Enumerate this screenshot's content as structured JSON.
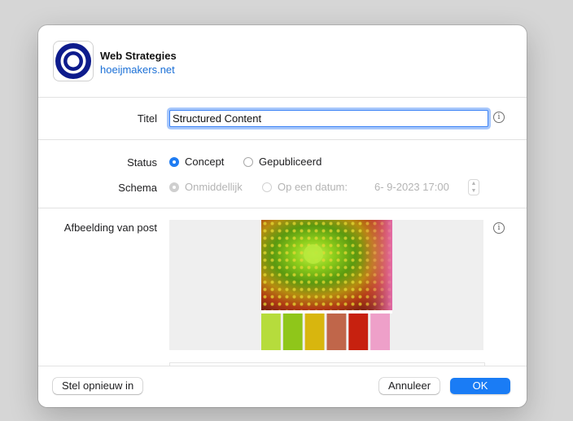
{
  "header": {
    "site_name": "Web Strategies",
    "site_url": "hoeijmakers.net",
    "icon": "concentric-circles-logo"
  },
  "title_row": {
    "label": "Titel",
    "value": "Structured Content",
    "info_icon": "info-circle-icon"
  },
  "status": {
    "label": "Status",
    "options": [
      "Concept",
      "Gepubliceerd"
    ],
    "selected": "Concept"
  },
  "schema": {
    "label": "Schema",
    "options": [
      "Onmiddellijk",
      "Op een datum:"
    ],
    "selected": "Onmiddellijk",
    "date_value": "6-  9-2023 17:00",
    "enabled": false
  },
  "featured_image": {
    "label": "Afbeelding van post",
    "info_icon": "info-circle-icon",
    "palette": [
      "#b6dc3c",
      "#8fc61a",
      "#d8b60e",
      "#c0664a",
      "#c7210f",
      "#eea0c9"
    ]
  },
  "footer": {
    "reset_label": "Stel opnieuw in",
    "cancel_label": "Annuleer",
    "ok_label": "OK"
  },
  "colors": {
    "accent": "#1a7cf5",
    "link": "#1a6fd6"
  }
}
